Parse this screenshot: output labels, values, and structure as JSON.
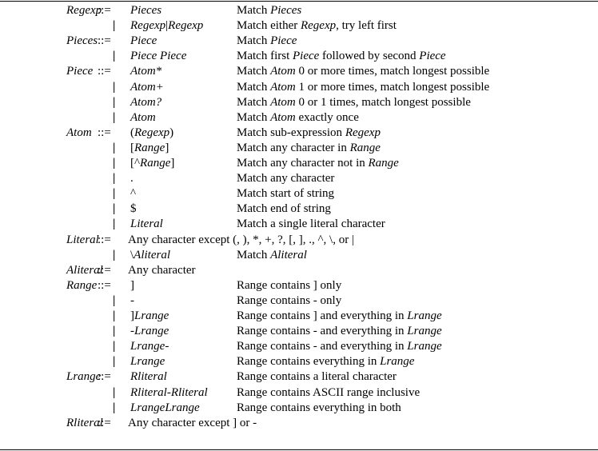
{
  "grammar": {
    "define_symbol": "::=",
    "alt_symbol": "|",
    "rows": [
      {
        "lhs": "Regexp",
        "rhs": [
          {
            "t": "Pieces",
            "i": true
          }
        ],
        "desc": [
          {
            "t": "Match "
          },
          {
            "t": "Pieces",
            "i": true
          }
        ]
      },
      {
        "lhs": "",
        "rhs": [
          {
            "t": "Regexp",
            "i": true
          },
          {
            "t": "|"
          },
          {
            "t": "Regexp",
            "i": true
          }
        ],
        "desc": [
          {
            "t": "Match either "
          },
          {
            "t": "Regexp",
            "i": true
          },
          {
            "t": ", try left first"
          }
        ]
      },
      {
        "lhs": "Pieces",
        "rhs": [
          {
            "t": "Piece",
            "i": true
          }
        ],
        "desc": [
          {
            "t": "Match "
          },
          {
            "t": "Piece",
            "i": true
          }
        ]
      },
      {
        "lhs": "",
        "rhs": [
          {
            "t": "Piece Piece",
            "i": true
          }
        ],
        "desc": [
          {
            "t": "Match first "
          },
          {
            "t": "Piece",
            "i": true
          },
          {
            "t": " followed by second "
          },
          {
            "t": "Piece",
            "i": true
          }
        ]
      },
      {
        "lhs": "Piece",
        "rhs": [
          {
            "t": "Atom*",
            "i": true
          }
        ],
        "desc": [
          {
            "t": "Match "
          },
          {
            "t": "Atom",
            "i": true
          },
          {
            "t": " 0 or more times, match longest possible"
          }
        ]
      },
      {
        "lhs": "",
        "rhs": [
          {
            "t": "Atom+",
            "i": true
          }
        ],
        "desc": [
          {
            "t": "Match "
          },
          {
            "t": "Atom",
            "i": true
          },
          {
            "t": " 1 or more times, match longest possible"
          }
        ]
      },
      {
        "lhs": "",
        "rhs": [
          {
            "t": "Atom?",
            "i": true
          }
        ],
        "desc": [
          {
            "t": "Match "
          },
          {
            "t": "Atom",
            "i": true
          },
          {
            "t": " 0 or 1 times, match longest possible"
          }
        ]
      },
      {
        "lhs": "",
        "rhs": [
          {
            "t": "Atom",
            "i": true
          }
        ],
        "desc": [
          {
            "t": "Match "
          },
          {
            "t": "Atom",
            "i": true
          },
          {
            "t": " exactly once"
          }
        ]
      },
      {
        "lhs": "Atom",
        "rhs": [
          {
            "t": "("
          },
          {
            "t": "Regexp",
            "i": true
          },
          {
            "t": ")"
          }
        ],
        "desc": [
          {
            "t": "Match sub-expression "
          },
          {
            "t": "Regexp",
            "i": true
          }
        ]
      },
      {
        "lhs": "",
        "rhs": [
          {
            "t": "["
          },
          {
            "t": "Range",
            "i": true
          },
          {
            "t": "]"
          }
        ],
        "desc": [
          {
            "t": "Match any character in "
          },
          {
            "t": "Range",
            "i": true
          }
        ]
      },
      {
        "lhs": "",
        "rhs": [
          {
            "t": "[^"
          },
          {
            "t": "Range",
            "i": true
          },
          {
            "t": "]"
          }
        ],
        "desc": [
          {
            "t": "Match any character not in "
          },
          {
            "t": "Range",
            "i": true
          }
        ]
      },
      {
        "lhs": "",
        "rhs": [
          {
            "t": "."
          }
        ],
        "desc": [
          {
            "t": "Match any character"
          }
        ]
      },
      {
        "lhs": "",
        "rhs": [
          {
            "t": "^"
          }
        ],
        "desc": [
          {
            "t": "Match start of string"
          }
        ]
      },
      {
        "lhs": "",
        "rhs": [
          {
            "t": "$"
          }
        ],
        "desc": [
          {
            "t": "Match end of string"
          }
        ]
      },
      {
        "lhs": "",
        "rhs": [
          {
            "t": "Literal",
            "i": true
          }
        ],
        "desc": [
          {
            "t": "Match a single literal character"
          }
        ]
      },
      {
        "lhs": "Literal",
        "full": "Any character except (, ), *, +, ?, [, ], ., ^, \\, or |"
      },
      {
        "lhs": "",
        "rhs": [
          {
            "t": "\\"
          },
          {
            "t": "Aliteral",
            "i": true
          }
        ],
        "desc": [
          {
            "t": "Match "
          },
          {
            "t": "Aliteral",
            "i": true
          }
        ]
      },
      {
        "lhs": "Aliteral",
        "full": "Any character"
      },
      {
        "lhs": "Range",
        "rhs": [
          {
            "t": "]"
          }
        ],
        "desc": [
          {
            "t": "Range contains ] only"
          }
        ]
      },
      {
        "lhs": "",
        "rhs": [
          {
            "t": "-"
          }
        ],
        "desc": [
          {
            "t": "Range contains - only"
          }
        ]
      },
      {
        "lhs": "",
        "rhs": [
          {
            "t": "]"
          },
          {
            "t": "Lrange",
            "i": true
          }
        ],
        "desc": [
          {
            "t": "Range contains ] and everything in "
          },
          {
            "t": "Lrange",
            "i": true
          }
        ]
      },
      {
        "lhs": "",
        "rhs": [
          {
            "t": "-Lrange",
            "i": true
          }
        ],
        "desc": [
          {
            "t": "Range contains - and everything in "
          },
          {
            "t": "Lrange",
            "i": true
          }
        ]
      },
      {
        "lhs": "",
        "rhs": [
          {
            "t": "Lrange-",
            "i": true
          }
        ],
        "desc": [
          {
            "t": "Range contains - and everything in "
          },
          {
            "t": "Lrange",
            "i": true
          }
        ]
      },
      {
        "lhs": "",
        "rhs": [
          {
            "t": "Lrange",
            "i": true
          }
        ],
        "desc": [
          {
            "t": "Range contains everything in "
          },
          {
            "t": "Lrange",
            "i": true
          }
        ]
      },
      {
        "lhs": "Lrange",
        "rhs": [
          {
            "t": "Rliteral",
            "i": true
          }
        ],
        "desc": [
          {
            "t": "Range contains a literal character"
          }
        ]
      },
      {
        "lhs": "",
        "rhs": [
          {
            "t": "Rliteral-Rliteral",
            "i": true
          }
        ],
        "desc": [
          {
            "t": "Range contains ASCII range inclusive"
          }
        ]
      },
      {
        "lhs": "",
        "rhs": [
          {
            "t": "LrangeLrange",
            "i": true
          }
        ],
        "desc": [
          {
            "t": "Range contains everything in both"
          }
        ]
      },
      {
        "lhs": "Rliteral",
        "full": "Any character except ] or -"
      }
    ]
  }
}
